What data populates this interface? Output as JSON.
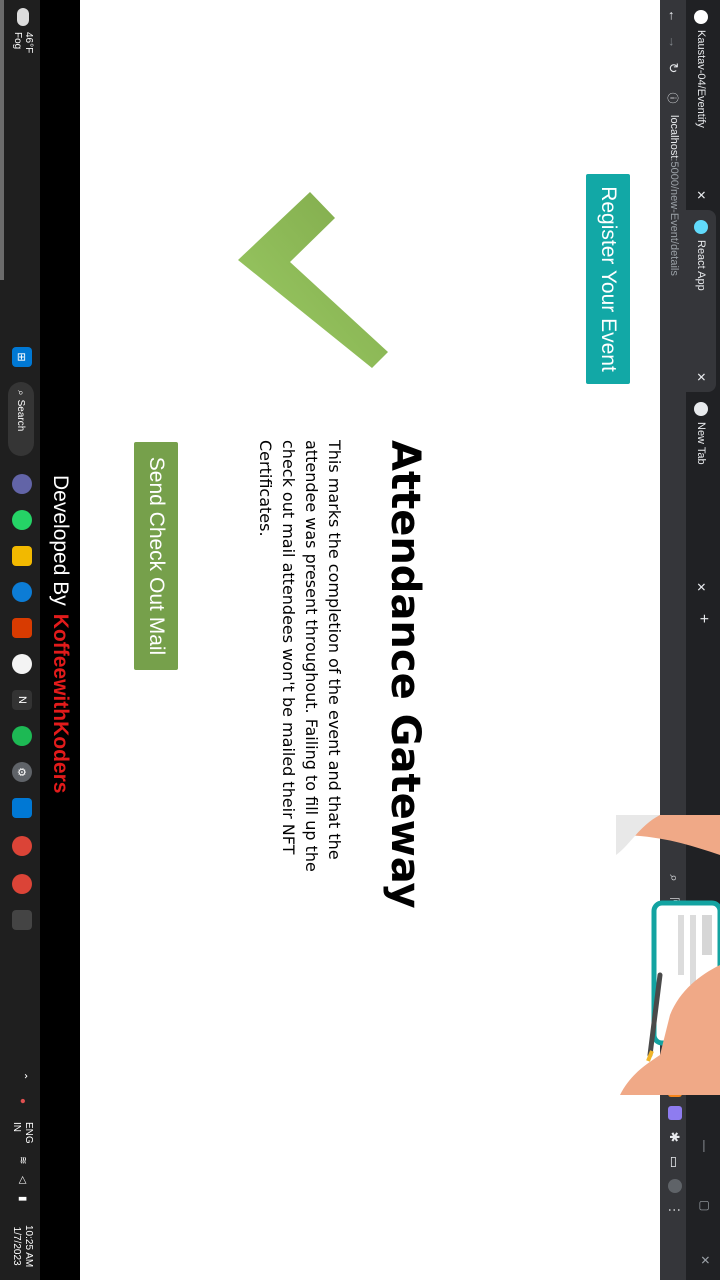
{
  "browser": {
    "tabs": [
      {
        "label": "Kaustav-04/Eventify",
        "icon": "github-icon"
      },
      {
        "label": "React App",
        "icon": "react-icon",
        "active": true
      },
      {
        "label": "New Tab",
        "icon": "chrome-icon"
      }
    ],
    "url_host": "localhost",
    "url_path": ":5000/new-Event/details"
  },
  "page": {
    "register_label": "Register Your Event",
    "title": "Attendance Gateway",
    "description": "This marks the completion of the event and that the attendee was present throughout. Failing to fill up the check out mail attendees won't be mailed their NFT Certificates.",
    "checkout_label": "Send Check Out Mail"
  },
  "footer": {
    "prefix": "Developed By",
    "brand": "KoffeewithKoders",
    "brand_color": "#e21b1b"
  },
  "taskbar": {
    "weather_temp": "46°F",
    "weather_cond": "Fog",
    "search_label": "Search",
    "lang_line1": "ENG",
    "lang_line2": "IN",
    "time": "10:25 AM",
    "date": "1/7/2023"
  },
  "colors": {
    "register_btn": "#12a8a6",
    "checkout_btn": "#76a04b",
    "check_mark": "#8bbd5a"
  }
}
